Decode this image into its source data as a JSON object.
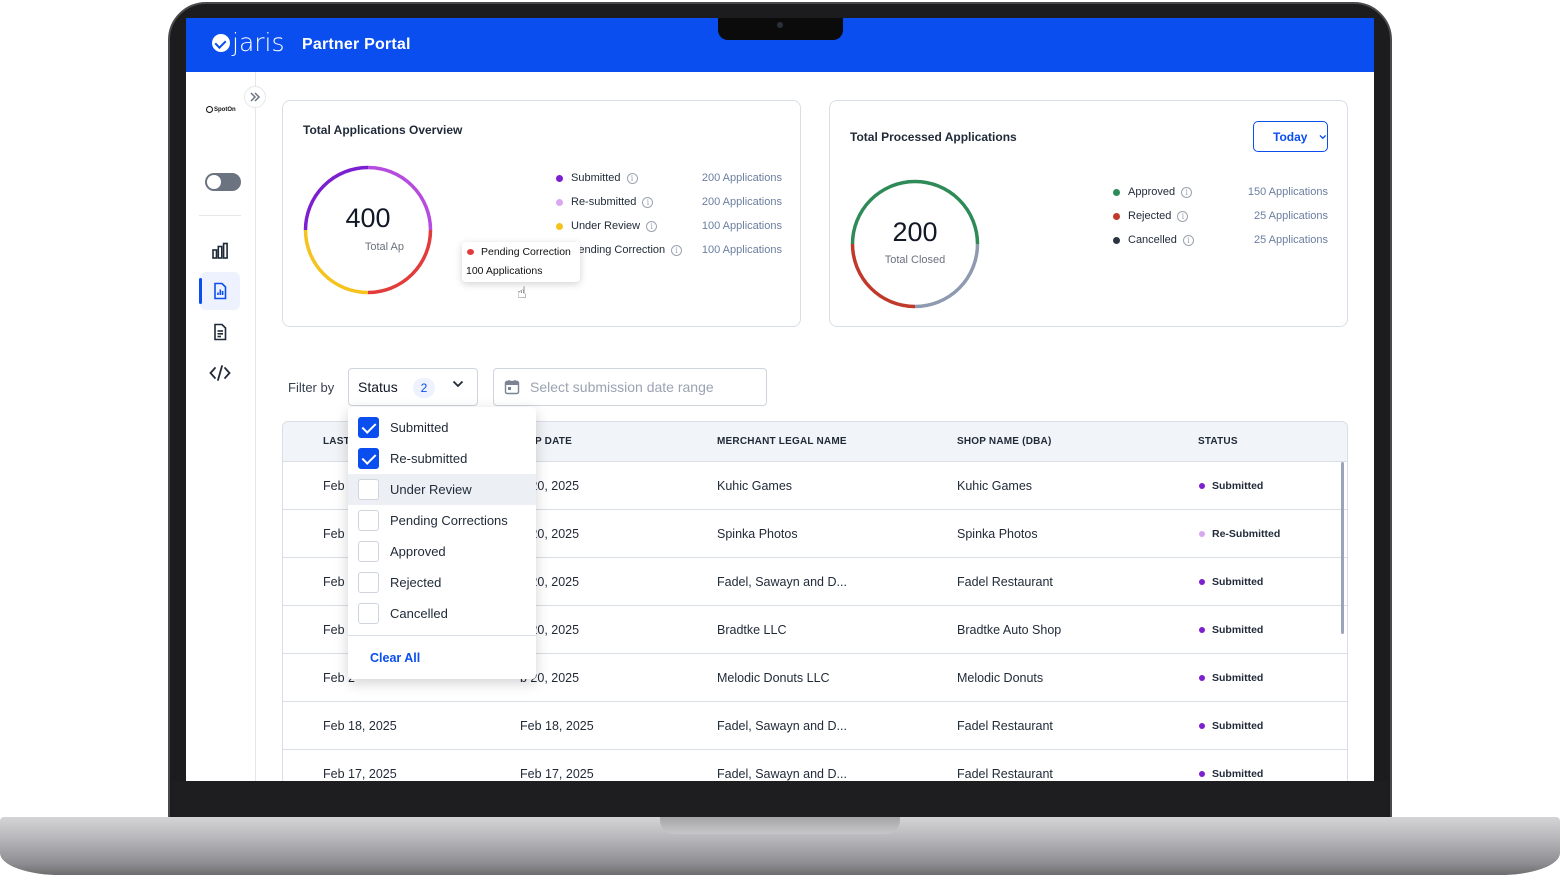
{
  "app": {
    "brand": "jaris",
    "title": "Partner Portal",
    "partner_logo": "SpotOn",
    "colors": {
      "primary": "#0a4ef0",
      "submitted": "#7c1fd1",
      "resubmitted": "#d8a8f0",
      "under_review": "#f5c31e",
      "pending_correction": "#e23b3b",
      "approved": "#2e8b57",
      "rejected": "#c0392b",
      "cancelled": "#2b3340"
    }
  },
  "sidebar": {
    "collapse_icon": "chevrons-right-icon",
    "items": [
      {
        "name": "dashboard",
        "icon": "bar-chart-icon",
        "active": false
      },
      {
        "name": "reports",
        "icon": "report-icon",
        "active": true
      },
      {
        "name": "applications",
        "icon": "document-icon",
        "active": false
      },
      {
        "name": "developer",
        "icon": "code-icon",
        "active": false
      }
    ]
  },
  "overview": {
    "title": "Total Applications Overview",
    "total": "400",
    "total_label": "Total Ap",
    "legend": [
      {
        "label": "Submitted",
        "value": "200 Applications",
        "color": "#7c1fd1"
      },
      {
        "label": "Re-submitted",
        "value": "200 Applications",
        "color": "#d8a8f0"
      },
      {
        "label": "Under Review",
        "value": "100 Applications",
        "color": "#f5c31e"
      },
      {
        "label": "Pending Correction",
        "value": "100 Applications",
        "color": "#e23b3b"
      }
    ],
    "tooltip": {
      "label": "Pending Correction",
      "value": "100 Applications"
    }
  },
  "processed": {
    "title": "Total Processed Applications",
    "period": "Today",
    "total": "200",
    "total_label": "Total Closed",
    "legend": [
      {
        "label": "Approved",
        "value": "150 Applications",
        "color": "#2e8b57"
      },
      {
        "label": "Rejected",
        "value": "25 Applications",
        "color": "#c0392b"
      },
      {
        "label": "Cancelled",
        "value": "25 Applications",
        "color": "#2b3340"
      }
    ]
  },
  "filters": {
    "label": "Filter by",
    "status_label": "Status",
    "status_count": "2",
    "date_placeholder": "Select submission date range",
    "options": [
      {
        "label": "Submitted",
        "checked": true
      },
      {
        "label": "Re-submitted",
        "checked": true
      },
      {
        "label": "Under Review",
        "checked": false
      },
      {
        "label": "Pending Corrections",
        "checked": false
      },
      {
        "label": "Approved",
        "checked": false
      },
      {
        "label": "Rejected",
        "checked": false
      },
      {
        "label": "Cancelled",
        "checked": false
      }
    ],
    "clear_all": "Clear All"
  },
  "table": {
    "columns": [
      "LAST",
      "P DATE",
      "MERCHANT LEGAL NAME",
      "SHOP NAME (DBA)",
      "STATUS"
    ],
    "rows": [
      {
        "last": "Feb :",
        "date": "b 20, 2025",
        "merchant": "Kuhic Games",
        "shop": "Kuhic Games",
        "status": "Submitted",
        "status_color": "#7c1fd1"
      },
      {
        "last": "Feb :",
        "date": "b 20, 2025",
        "merchant": "Spinka Photos",
        "shop": "Spinka Photos",
        "status": "Re-Submitted",
        "status_color": "#d8a8f0"
      },
      {
        "last": "Feb :",
        "date": "b 20, 2025",
        "merchant": "Fadel, Sawayn and D...",
        "shop": "Fadel Restaurant",
        "status": "Submitted",
        "status_color": "#7c1fd1"
      },
      {
        "last": "Feb :",
        "date": "b 20, 2025",
        "merchant": "Bradtke LLC",
        "shop": "Bradtke Auto Shop",
        "status": "Submitted",
        "status_color": "#7c1fd1"
      },
      {
        "last": "Feb 2",
        "date": "b 20, 2025",
        "merchant": "Melodic Donuts LLC",
        "shop": "Melodic Donuts",
        "status": "Submitted",
        "status_color": "#7c1fd1"
      },
      {
        "last": "Feb 18, 2025",
        "date": "Feb 18, 2025",
        "merchant": "Fadel, Sawayn and D...",
        "shop": "Fadel Restaurant",
        "status": "Submitted",
        "status_color": "#7c1fd1"
      },
      {
        "last": "Feb 17, 2025",
        "date": "Feb 17, 2025",
        "merchant": "Fadel, Sawayn and D...",
        "shop": "Fadel Restaurant",
        "status": "Submitted",
        "status_color": "#7c1fd1"
      }
    ]
  }
}
